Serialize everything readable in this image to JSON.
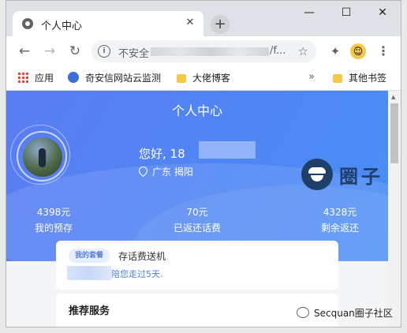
{
  "browser": {
    "tab_title": "个人中心",
    "tab_close": "✕",
    "new_tab": "+",
    "minimize": "—",
    "maximize": "☐",
    "close": "✕",
    "back": "←",
    "forward": "→",
    "reload": "↻",
    "url_insecure": "不安全",
    "url_tail": "/f...",
    "star": "☆",
    "extensions_icon": "puzzle-icon",
    "profile_icon": "emoji-avatar-icon",
    "menu": "⋮"
  },
  "bookmarks": {
    "items": [
      "应用",
      "奇安信网站云监测",
      "大佬博客"
    ],
    "more": "»",
    "other": "其他书签"
  },
  "page": {
    "title": "个人中心",
    "greeting": "您好, 18",
    "location": "广东  揭阳",
    "stats": [
      {
        "value": "4398元",
        "label": "我的预存"
      },
      {
        "value": "70元",
        "label": "已返还话费"
      },
      {
        "value": "4328元",
        "label": "剩余返还"
      }
    ],
    "package": {
      "tag": "我的套餐",
      "name": "存话费送机",
      "message": "陪您走过5天."
    },
    "services_title": "推荐服务"
  },
  "watermark": {
    "logo_text": "圈子",
    "footer": "Secquan圈子社区"
  },
  "colors": {
    "hero_start": "#5b7df1",
    "hero_end": "#4a8ef5",
    "link_blue": "#4a82e6"
  }
}
